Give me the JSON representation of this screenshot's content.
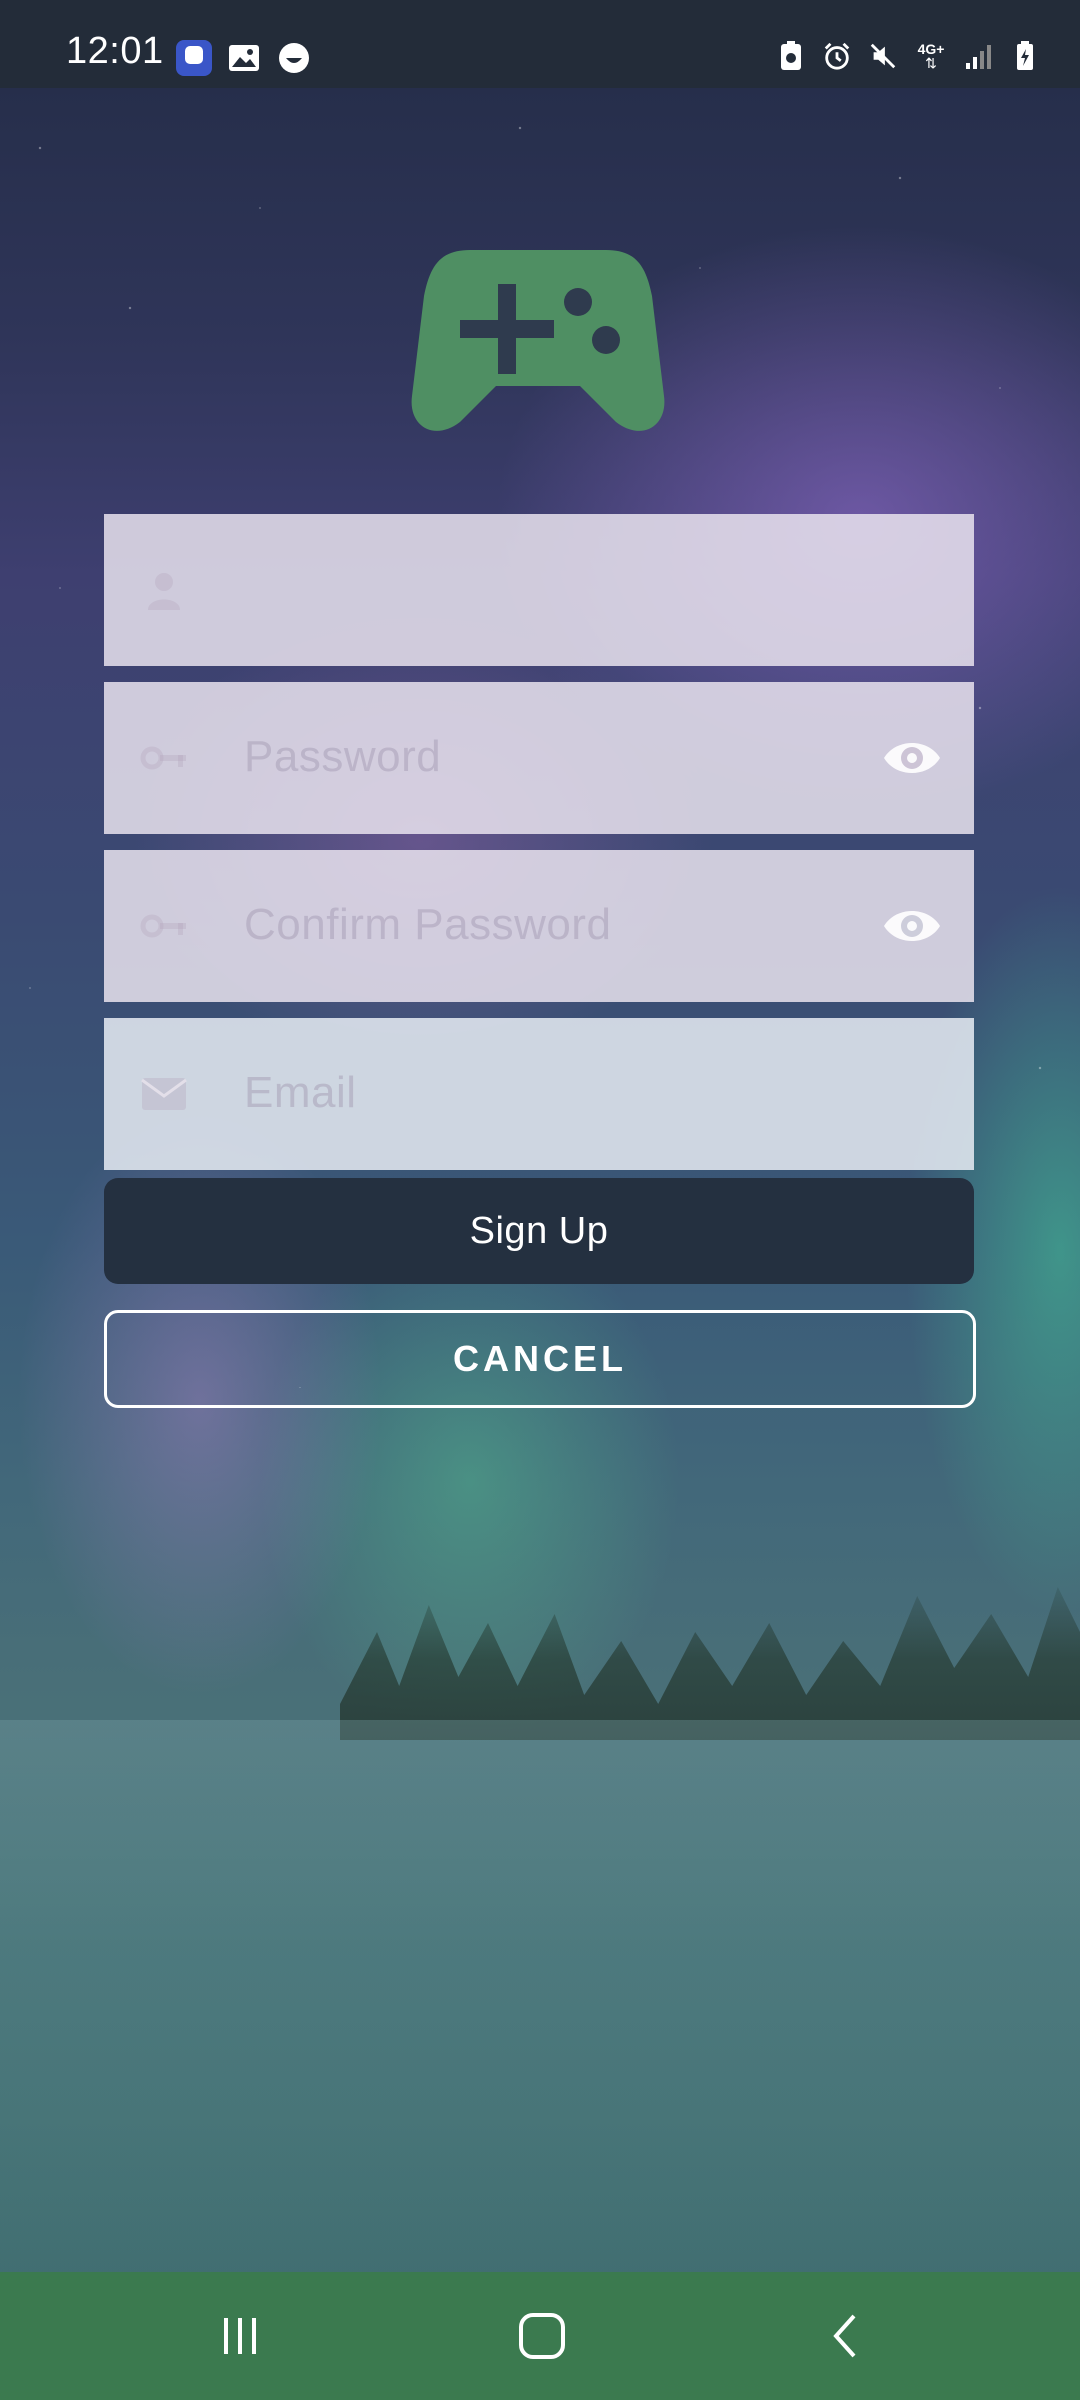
{
  "status_bar": {
    "time": "12:01",
    "left_icons": [
      "app-notification-icon",
      "image-icon",
      "emoji-icon"
    ],
    "right_icons": [
      "data-saver-icon",
      "alarm-icon",
      "mute-icon",
      "network-4g-icon",
      "signal-icon",
      "battery-charging-icon"
    ],
    "network_label": "4G+"
  },
  "logo": {
    "icon": "gamepad-icon",
    "color": "#4f8f63"
  },
  "form": {
    "username": {
      "icon": "person-icon",
      "placeholder": ""
    },
    "password": {
      "icon": "key-icon",
      "placeholder": "Password",
      "toggle_icon": "eye-icon"
    },
    "confirm_password": {
      "icon": "key-icon",
      "placeholder": "Confirm Password",
      "toggle_icon": "eye-icon"
    },
    "email": {
      "icon": "envelope-icon",
      "placeholder": "Email"
    }
  },
  "buttons": {
    "signup_label": "Sign Up",
    "cancel_label": "CANCEL"
  },
  "nav_bar": {
    "recent": "recent-apps-icon",
    "home": "home-icon",
    "back": "back-icon",
    "color": "#3b7a4f"
  }
}
